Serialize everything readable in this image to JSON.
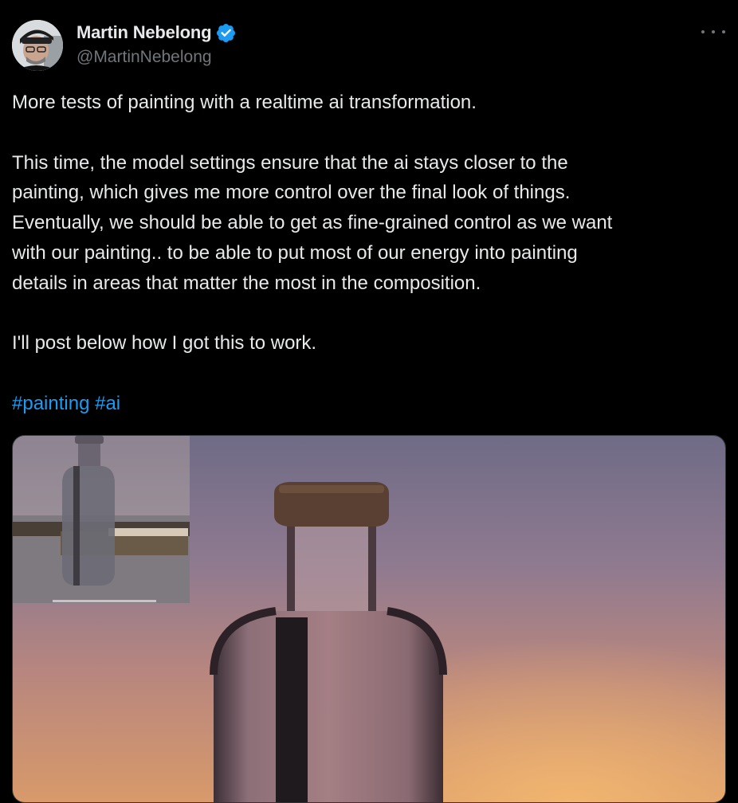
{
  "author": {
    "display_name": "Martin Nebelong",
    "handle": "@MartinNebelong",
    "verified": true,
    "avatar_icon": "profile-photo"
  },
  "more_button": {
    "icon": "more-options-icon"
  },
  "tweet": {
    "paragraphs": [
      [
        "More tests of painting with a realtime ai transformation."
      ],
      [
        "This time, the model settings ensure that the ai stays closer to the",
        "painting, which gives me more control over the final look of things.",
        "Eventually, we should be able to get as fine-grained control as we want",
        "with our painting.. to be able to put most of our energy into painting",
        "details in areas that matter the most in the composition."
      ],
      [
        "I'll post below how I got this to work."
      ]
    ],
    "hashtags": [
      "#painting",
      "#ai"
    ]
  },
  "colors": {
    "background": "#000000",
    "text": "#e7e9ea",
    "secondary_text": "#71767b",
    "link": "#1d9bf0",
    "verified_badge": "#1d9bf0"
  }
}
